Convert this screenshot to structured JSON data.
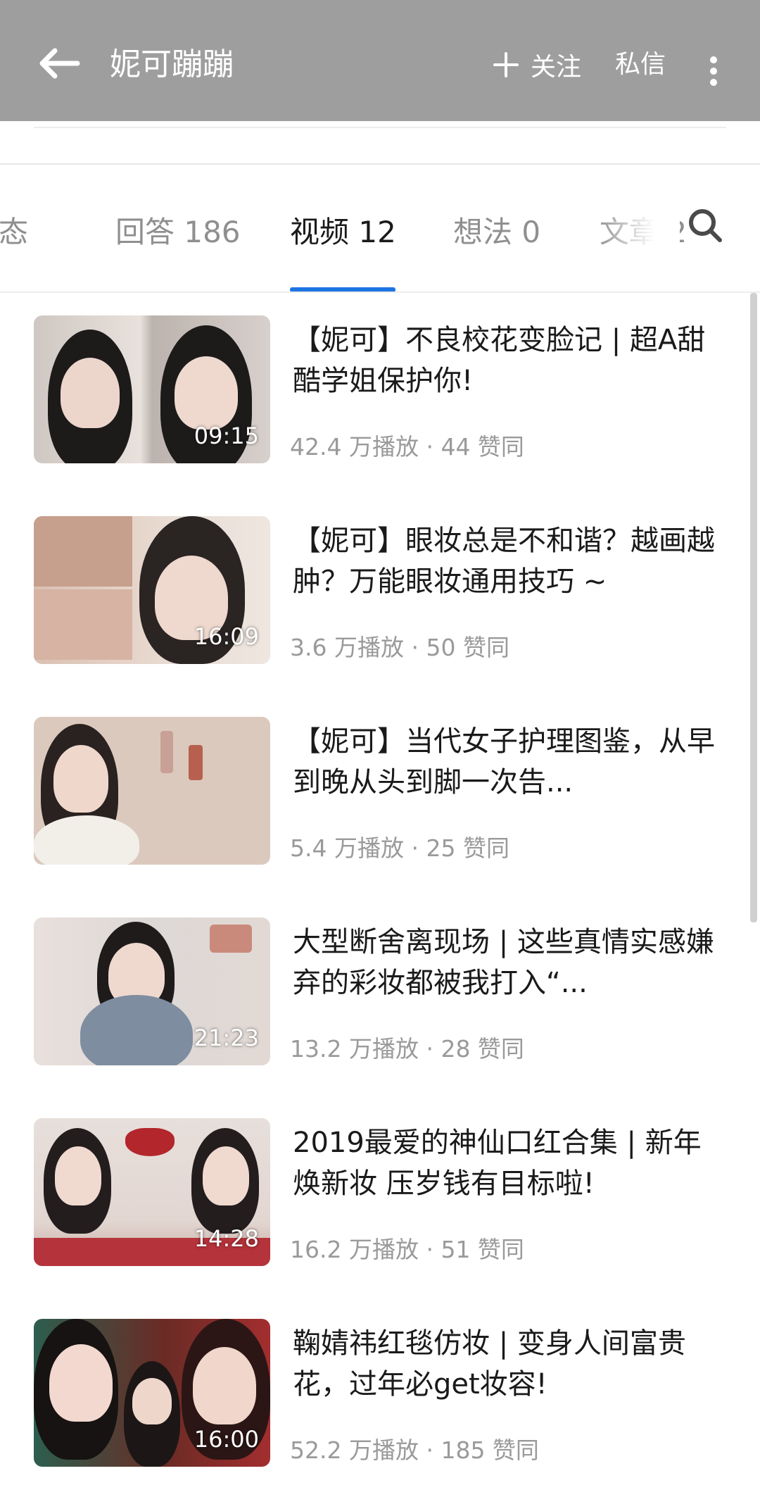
{
  "header": {
    "title": "妮可蹦蹦",
    "follow_label": "关注",
    "message_label": "私信",
    "icons": [
      "back-arrow-icon",
      "plus-icon",
      "more-vertical-icon"
    ]
  },
  "tabs": [
    {
      "label": "动态"
    },
    {
      "label": "回答 186"
    },
    {
      "label": "视频 12",
      "active": true
    },
    {
      "label": "想法 0"
    },
    {
      "label": "文章 2"
    }
  ],
  "accent_color": "#1e74e3",
  "videos": [
    {
      "title": "【妮可】不良校花变脸记 | 超A甜酷学姐保护你!",
      "duration": "09:15",
      "views": "42.4 万播放",
      "likes": "44 赞同"
    },
    {
      "title": "【妮可】眼妆总是不和谐？越画越肿？万能眼妆通用技巧 ~",
      "duration": "16:09",
      "views": "3.6 万播放",
      "likes": "50 赞同"
    },
    {
      "title": "【妮可】当代女子护理图鉴，从早到晚从头到脚一次告...",
      "duration": "",
      "views": "5.4 万播放",
      "likes": "25 赞同"
    },
    {
      "title": "大型断舍离现场 | 这些真情实感嫌弃的彩妆都被我打入“...",
      "duration": "21:23",
      "views": "13.2 万播放",
      "likes": "28 赞同"
    },
    {
      "title": "2019最爱的神仙口红合集 | 新年焕新妆 压岁钱有目标啦!",
      "duration": "14:28",
      "views": "16.2 万播放",
      "likes": "51 赞同"
    },
    {
      "title": "鞠婧祎红毯仿妆 | 变身人间富贵花，过年必get妆容!",
      "duration": "16:00",
      "views": "52.2 万播放",
      "likes": "185 赞同"
    }
  ]
}
